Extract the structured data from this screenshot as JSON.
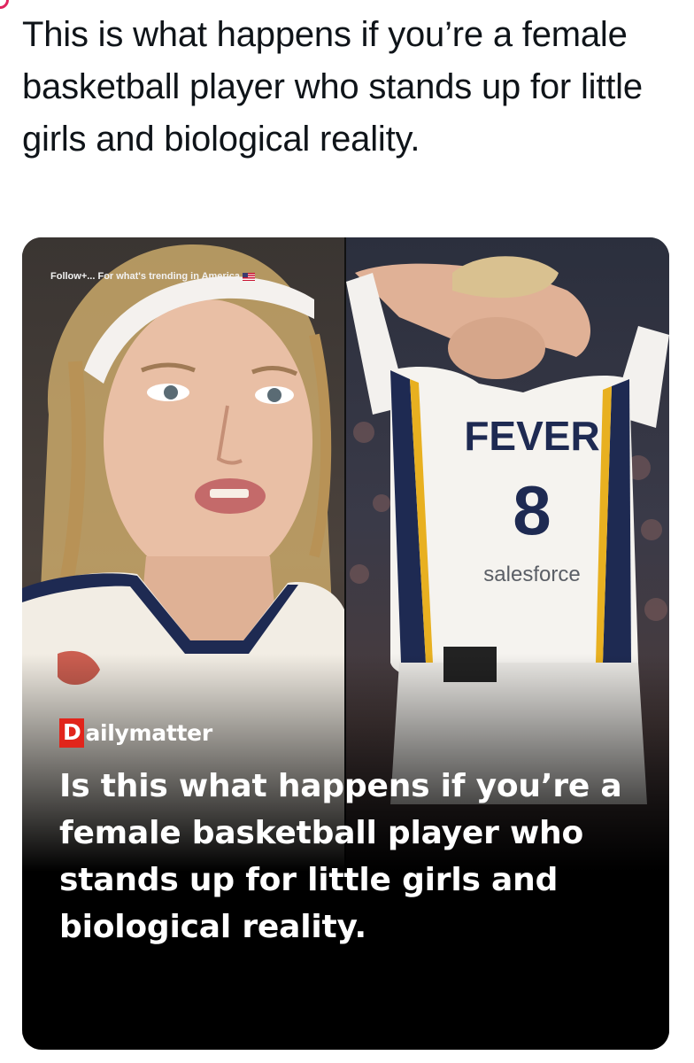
{
  "post": {
    "text": "This is what happens if you’re a female basketball player who stands up for little girls and biological reality."
  },
  "media": {
    "left_photo": {
      "overlay_text": "Follow+... For what's trending in America"
    },
    "right_photo": {
      "jersey_team": "FEVER",
      "jersey_number": "8",
      "jersey_sponsor": "salesforce"
    },
    "brand": {
      "first_letter": "D",
      "rest": "ailymatter"
    },
    "headline": "Is this what happens if you’re a female basketball player who stands up for little girls and biological reality."
  },
  "colors": {
    "brand_red": "#e1251b",
    "headline_text": "#ffffff",
    "post_text": "#0f1419"
  },
  "icons": [
    "us-flag-icon"
  ]
}
